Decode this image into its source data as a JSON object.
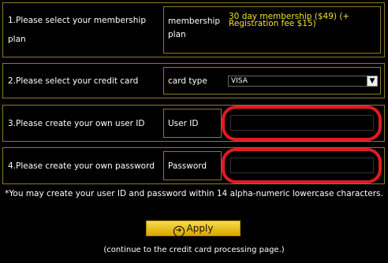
{
  "steps": [
    {
      "label": "1.Please select your membership plan",
      "key": "membership plan",
      "value": "30 day membership ($49) (+ Registration fee  $15)"
    },
    {
      "label": "2.Please select your credit card",
      "key": "card type",
      "value": "VISA"
    },
    {
      "label": "3.Please create your own user ID",
      "key": "User ID",
      "value": ""
    },
    {
      "label": "4.Please create your own password",
      "key": "Password",
      "value": ""
    }
  ],
  "note": "*You may create your user ID and password within 14 alpha-numeric lowercase characters.",
  "apply_label": "Apply",
  "continue_note": "(continue to the credit card processing page.)",
  "colors": {
    "background": "#000000",
    "border": "#8a7a2a",
    "highlight": "#e01a24",
    "button": "#f0cc20",
    "value": "#f0e02a"
  },
  "icons": {
    "apply": "circle-arrow-right-icon",
    "select": "chevron-down-icon"
  }
}
